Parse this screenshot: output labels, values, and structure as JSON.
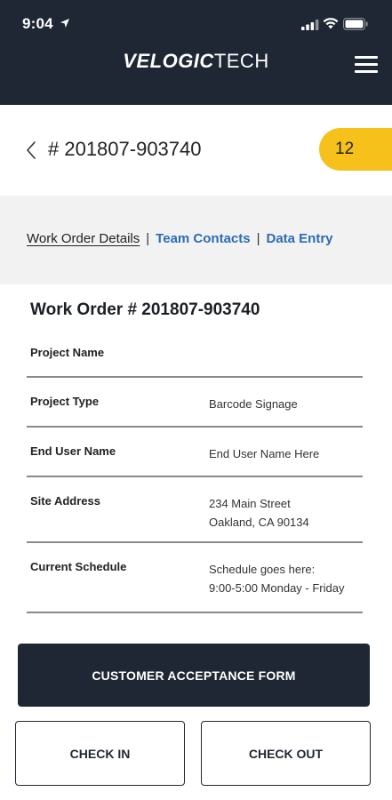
{
  "status_bar": {
    "time": "9:04"
  },
  "header": {
    "logo_part1": "VELOGIC",
    "logo_part2": "TECH"
  },
  "work_order": {
    "title": "# 201807-903740",
    "count_badge": "12"
  },
  "tabs": [
    {
      "label": "Work Order Details",
      "active": true
    },
    {
      "label": "Team Contacts",
      "active": false
    },
    {
      "label": "Data Entry",
      "active": false
    }
  ],
  "tab_separator": "|",
  "details": {
    "heading": "Work Order # 201807-903740",
    "rows": [
      {
        "label": "Project Name",
        "value_lines": []
      },
      {
        "label": "Project Type",
        "value_lines": [
          "Barcode Signage"
        ]
      },
      {
        "label": "End User Name",
        "value_lines": [
          "End User Name Here"
        ]
      },
      {
        "label": "Site Address",
        "value_lines": [
          "234 Main Street",
          "Oakland, CA 90134"
        ]
      },
      {
        "label": "Current Schedule",
        "value_lines": [
          "Schedule goes here:",
          "9:00-5:00 Monday - Friday"
        ]
      }
    ]
  },
  "buttons": {
    "customer_acceptance": "CUSTOMER ACCEPTANCE FORM",
    "check_in": "CHECK IN",
    "check_out": "CHECK OUT"
  },
  "colors": {
    "header_bg": "#1e2733",
    "badge_bg": "#f6c11a",
    "tab_link": "#2b6bb5",
    "tabs_band_bg": "#f2f2f2"
  },
  "icons": [
    "location-arrow-icon",
    "cellular-signal-icon",
    "wifi-icon",
    "battery-icon",
    "hamburger-menu-icon",
    "chevron-left-icon"
  ]
}
